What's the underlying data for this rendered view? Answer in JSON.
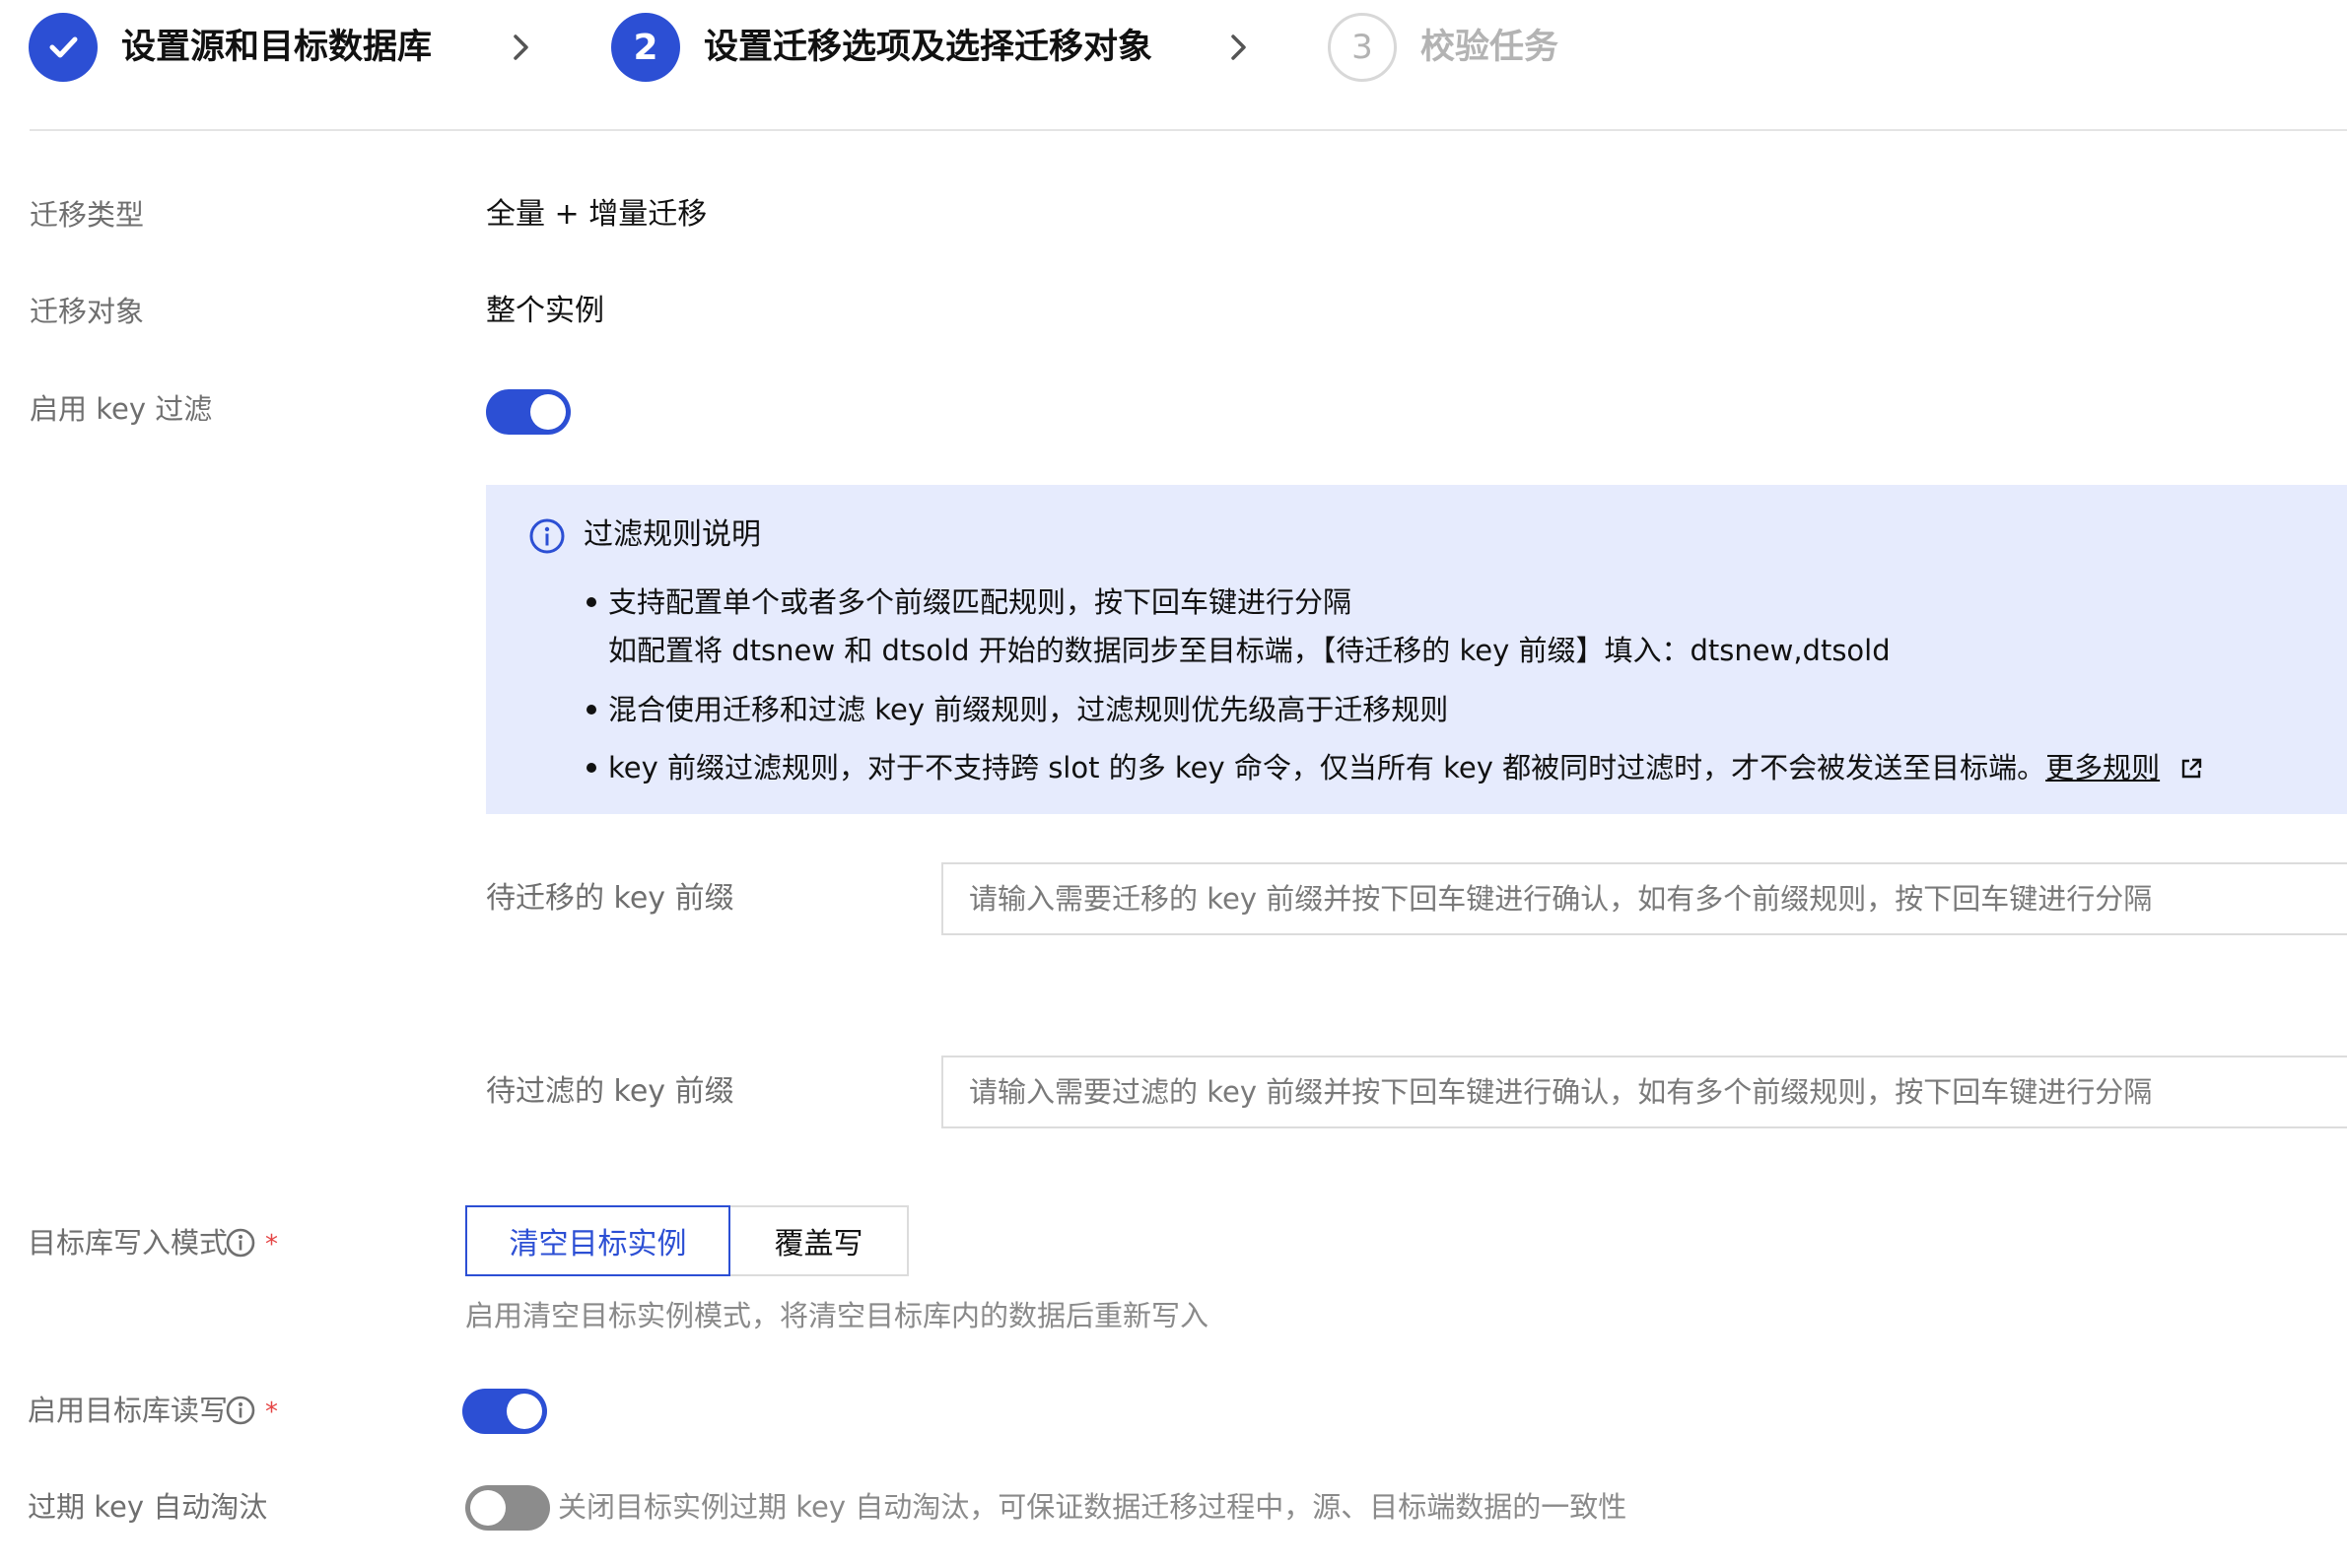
{
  "steps": [
    {
      "label": "设置源和目标数据库",
      "state": "done",
      "icon": "check-icon"
    },
    {
      "number": "2",
      "label": "设置迁移选项及选择迁移对象",
      "state": "active"
    },
    {
      "number": "3",
      "label": "校验任务",
      "state": "pending"
    }
  ],
  "form": {
    "migration_type": {
      "label": "迁移类型",
      "value": "全量 + 增量迁移"
    },
    "migration_object": {
      "label": "迁移对象",
      "value": "整个实例"
    },
    "key_filter": {
      "label": "启用 key 过滤",
      "enabled": true
    },
    "filter_info": {
      "title": "过滤规则说明",
      "bullets": [
        {
          "line1": "支持配置单个或者多个前缀匹配规则，按下回车键进行分隔",
          "line2": "如配置将 dtsnew 和 dtsold 开始的数据同步至目标端，【待迁移的 key 前缀】填入：dtsnew,dtsold"
        },
        {
          "line1": "混合使用迁移和过滤 key 前缀规则，过滤规则优先级高于迁移规则"
        },
        {
          "line1": "key 前缀过滤规则，对于不支持跨 slot 的多 key 命令，仅当所有 key 都被同时过滤时，才不会被发送至目标端。",
          "link": "更多规则"
        }
      ]
    },
    "migrate_prefix": {
      "label": "待迁移的 key 前缀",
      "placeholder": "请输入需要迁移的 key 前缀并按下回车键进行确认，如有多个前缀规则，按下回车键进行分隔",
      "value": ""
    },
    "filter_prefix": {
      "label": "待过滤的 key 前缀",
      "placeholder": "请输入需要过滤的 key 前缀并按下回车键进行确认，如有多个前缀规则，按下回车键进行分隔",
      "value": ""
    },
    "write_mode": {
      "label": "目标库写入模式",
      "required_mark": "*",
      "options": [
        "清空目标实例",
        "覆盖写"
      ],
      "selected": "清空目标实例",
      "hint": "启用清空目标实例模式，将清空目标库内的数据后重新写入"
    },
    "target_rw": {
      "label": "启用目标库读写",
      "required_mark": "*",
      "enabled": true
    },
    "expire_key": {
      "label": "过期 key 自动淘汰",
      "enabled": false,
      "hint": "关闭目标实例过期 key 自动淘汰，可保证数据迁移过程中，源、目标端数据的一致性"
    }
  },
  "colors": {
    "accent": "#2c4fd4",
    "info_bg": "#e6ebfd",
    "required": "#e54545",
    "muted": "#6f6f6f",
    "toggle_off": "#8c8c8c"
  }
}
